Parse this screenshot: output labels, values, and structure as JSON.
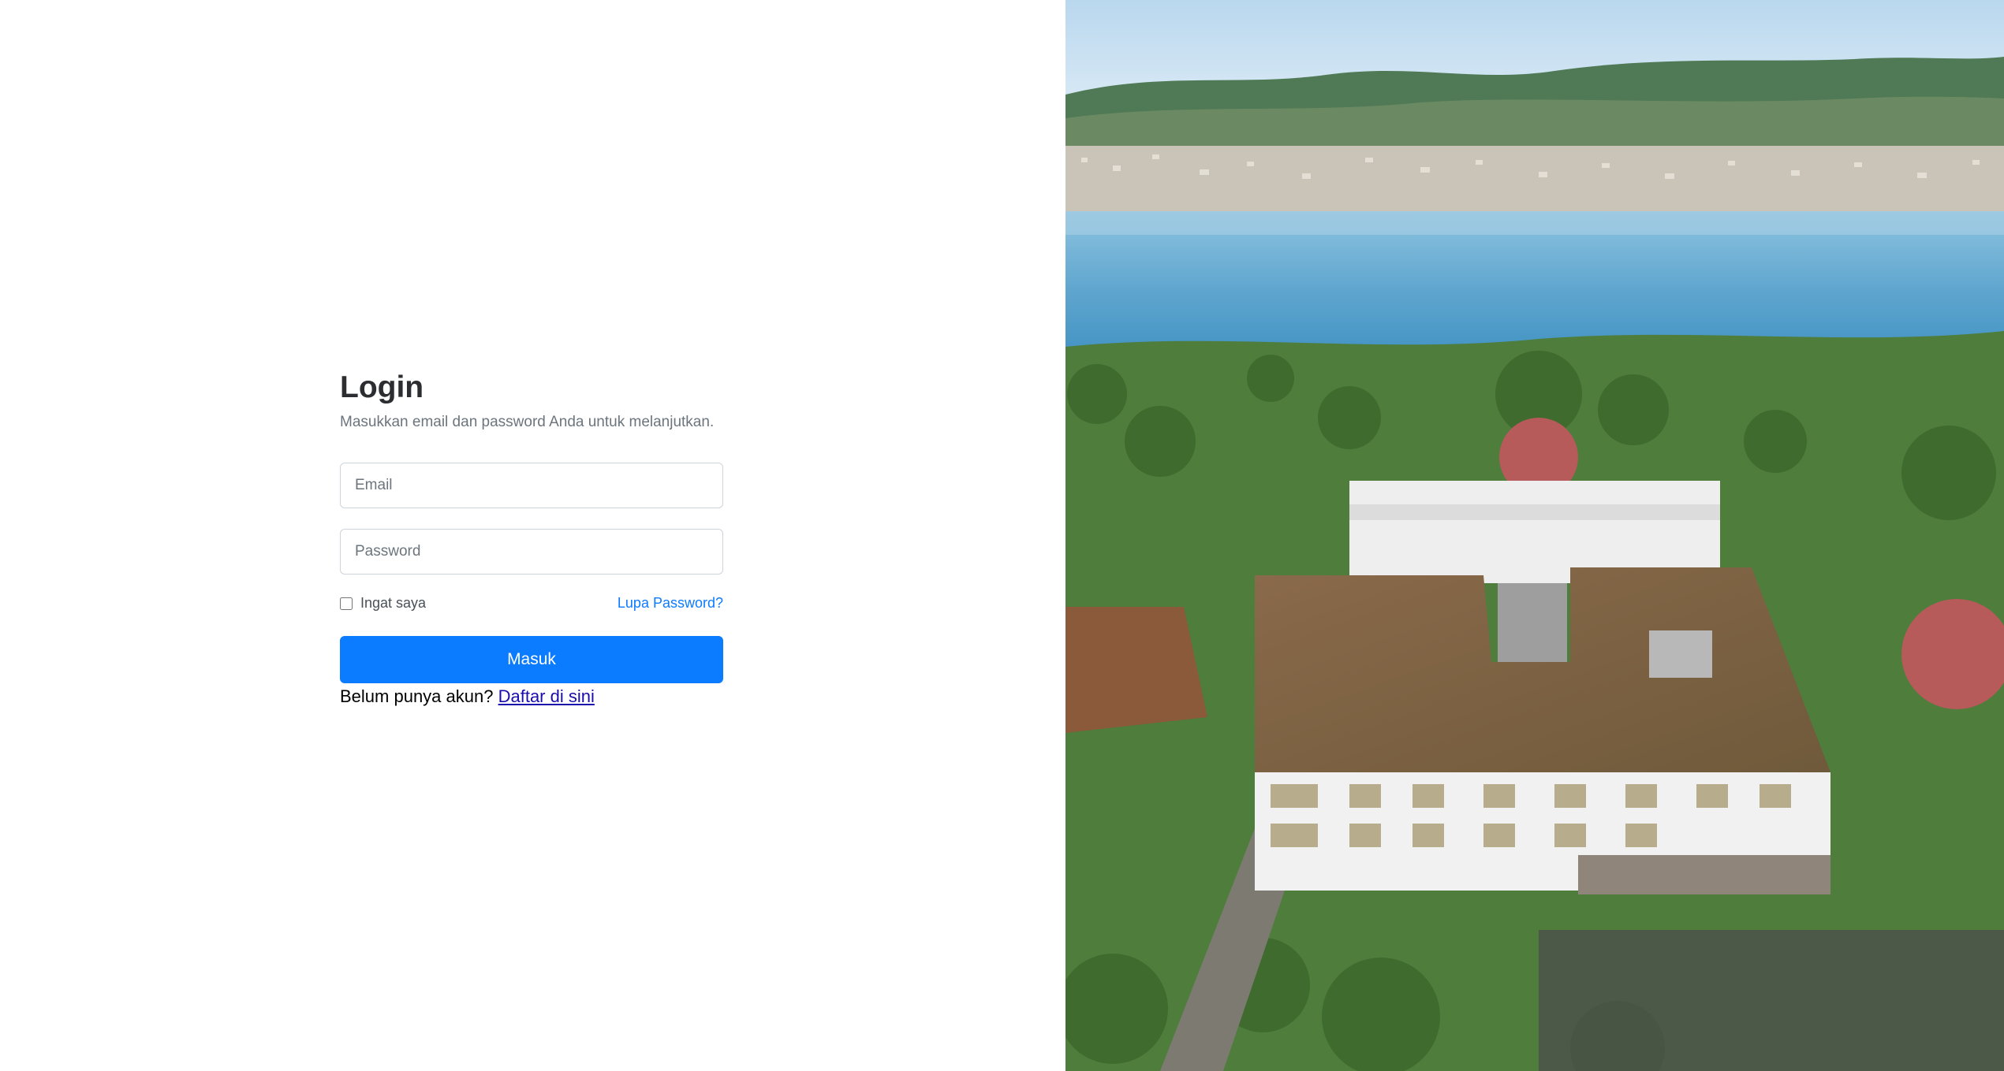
{
  "login": {
    "title": "Login",
    "subtitle": "Masukkan email dan password Anda untuk melanjutkan.",
    "email_placeholder": "Email",
    "password_placeholder": "Password",
    "remember_label": "Ingat saya",
    "forgot_link": "Lupa Password?",
    "submit_label": "Masuk",
    "signup_prompt": "Belum punya akun?",
    "signup_link": "Daftar di sini"
  },
  "theme": {
    "primary": "#0b7bff",
    "link": "#0d7bff",
    "muted_text": "#6c757d",
    "heading_text": "#2b2d30"
  }
}
